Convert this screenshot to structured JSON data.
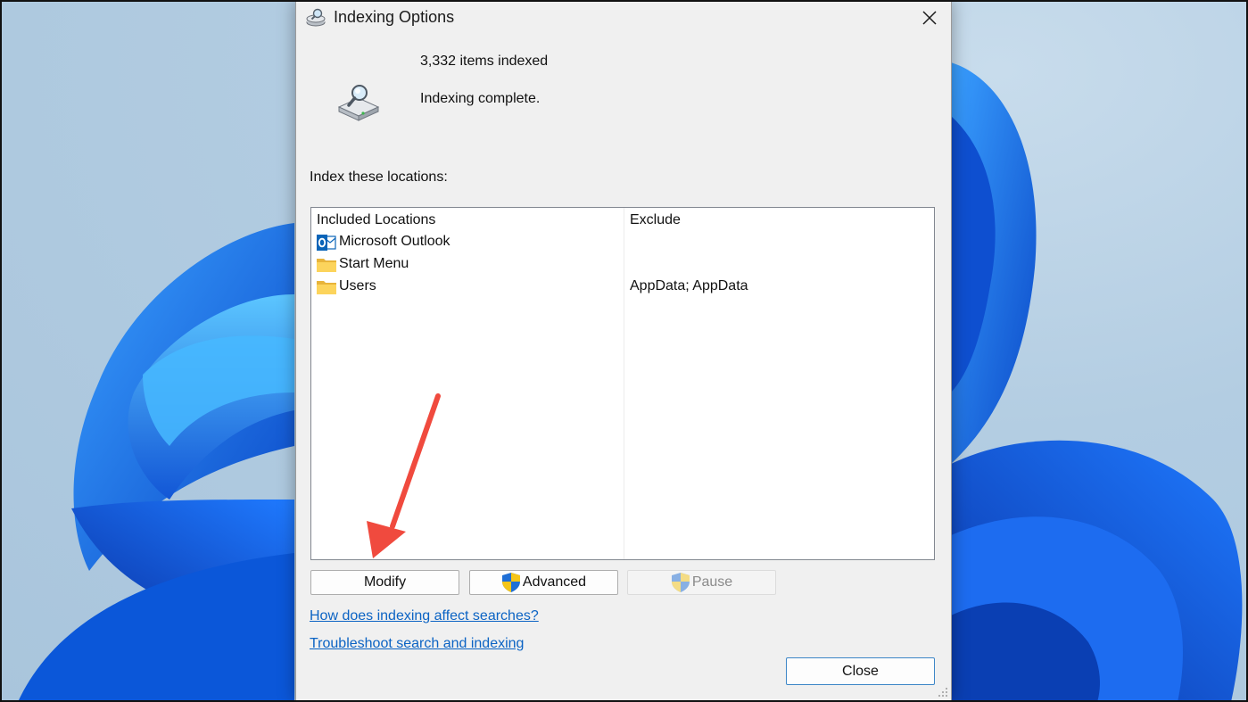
{
  "window": {
    "title": "Indexing Options",
    "title_icon": "indexing-options-icon",
    "close_icon": "close-icon"
  },
  "status": {
    "items_indexed": "3,332 items indexed",
    "message": "Indexing complete.",
    "icon": "drive-magnifier-icon"
  },
  "locations": {
    "label": "Index these locations:",
    "columns": [
      "Included Locations",
      "Exclude"
    ],
    "rows": [
      {
        "name": "Microsoft Outlook",
        "exclude": "",
        "icon": "outlook-icon"
      },
      {
        "name": "Start Menu",
        "exclude": "",
        "icon": "folder-icon"
      },
      {
        "name": "Users",
        "exclude": "AppData; AppData",
        "icon": "folder-icon"
      }
    ]
  },
  "buttons": {
    "modify": "Modify",
    "advanced": "Advanced",
    "pause": "Pause",
    "close": "Close"
  },
  "links": {
    "help": "How does indexing affect searches?",
    "troubleshoot": "Troubleshoot search and indexing"
  },
  "colors": {
    "link": "#0b63c4",
    "annotation_arrow": "#f04a3e",
    "wallpaper_blue": "#1a6be6"
  }
}
